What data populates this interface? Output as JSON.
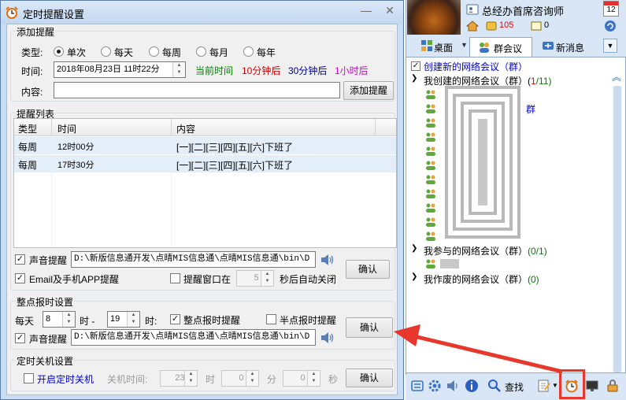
{
  "dialog": {
    "title": "定时提醒设置",
    "add_section": {
      "legend": "添加提醒",
      "type_label": "类型:",
      "types": [
        "单次",
        "每天",
        "每周",
        "每月",
        "每年"
      ],
      "selected_type": "单次",
      "time_label": "时间:",
      "time_value": "2018年08月23日 11时22分",
      "quick_links": [
        "当前时间",
        "10分钟后",
        "30分钟后",
        "1小时后"
      ],
      "quick_colors": [
        "#008000",
        "#cc0000",
        "#000099",
        "#cc00cc"
      ],
      "content_label": "内容:",
      "content_value": "",
      "add_button": "添加提醒"
    },
    "list_section": {
      "legend": "提醒列表",
      "columns": [
        "类型",
        "时间",
        "内容"
      ],
      "rows": [
        {
          "type": "每周",
          "time": "12时00分",
          "content": "[一][二][三][四][五][六]下班了"
        },
        {
          "type": "每周",
          "time": "17时30分",
          "content": "[一][二][三][四][五][六]下班了"
        }
      ],
      "sound_label": "声音提醒",
      "sound_path": "D:\\新版信息通开发\\点晴MIS信息通\\点晴MIS信息通\\bin\\D",
      "email_label": "Email及手机APP提醒",
      "popup_label": "提醒窗口在",
      "popup_seconds": "5",
      "popup_suffix": "秒后自动关闭",
      "confirm": "确认"
    },
    "hourly_section": {
      "legend": "整点报时设置",
      "each_day": "每天",
      "from_hour": "8",
      "hour_dash": "时 -",
      "to_hour": "19",
      "hour_suffix": "时:",
      "hourly_label": "整点报时提醒",
      "half_label": "半点报时提醒",
      "sound_label": "声音提醒",
      "sound_path": "D:\\新版信息通开发\\点晴MIS信息通\\点晴MIS信息通\\bin\\D",
      "confirm": "确认"
    },
    "shutdown_section": {
      "legend": "定时关机设置",
      "enable_label": "开启定时关机",
      "time_label": "关机时间:",
      "hour": "23",
      "hour_unit": "时",
      "minute": "0",
      "minute_unit": "分",
      "second": "0",
      "second_unit": "秒",
      "confirm": "确认"
    }
  },
  "right_panel": {
    "user_name": "总经办首席咨询师",
    "calendar_day": "12",
    "coins": "105",
    "messages": "0",
    "tabs": [
      "桌面",
      "群会议",
      "新消息"
    ],
    "tree": {
      "create_link": "创建新的网络会议（群）",
      "my_created": "我创建的网络会议（群）",
      "my_created_count_open": "(",
      "my_created_count_red": "1",
      "my_created_count_rest": "/11)",
      "joined": "我参与的网络会议（群）",
      "joined_count": "(0/1)",
      "dissolved": "我作废的网络会议（群）",
      "dissolved_count": "(0)",
      "partial_text": "群"
    },
    "bottom": {
      "search_label": "查找"
    }
  },
  "colors": {
    "accent_red": "#e8372c",
    "link_blue": "#0000cc",
    "count_green": "#008000"
  }
}
